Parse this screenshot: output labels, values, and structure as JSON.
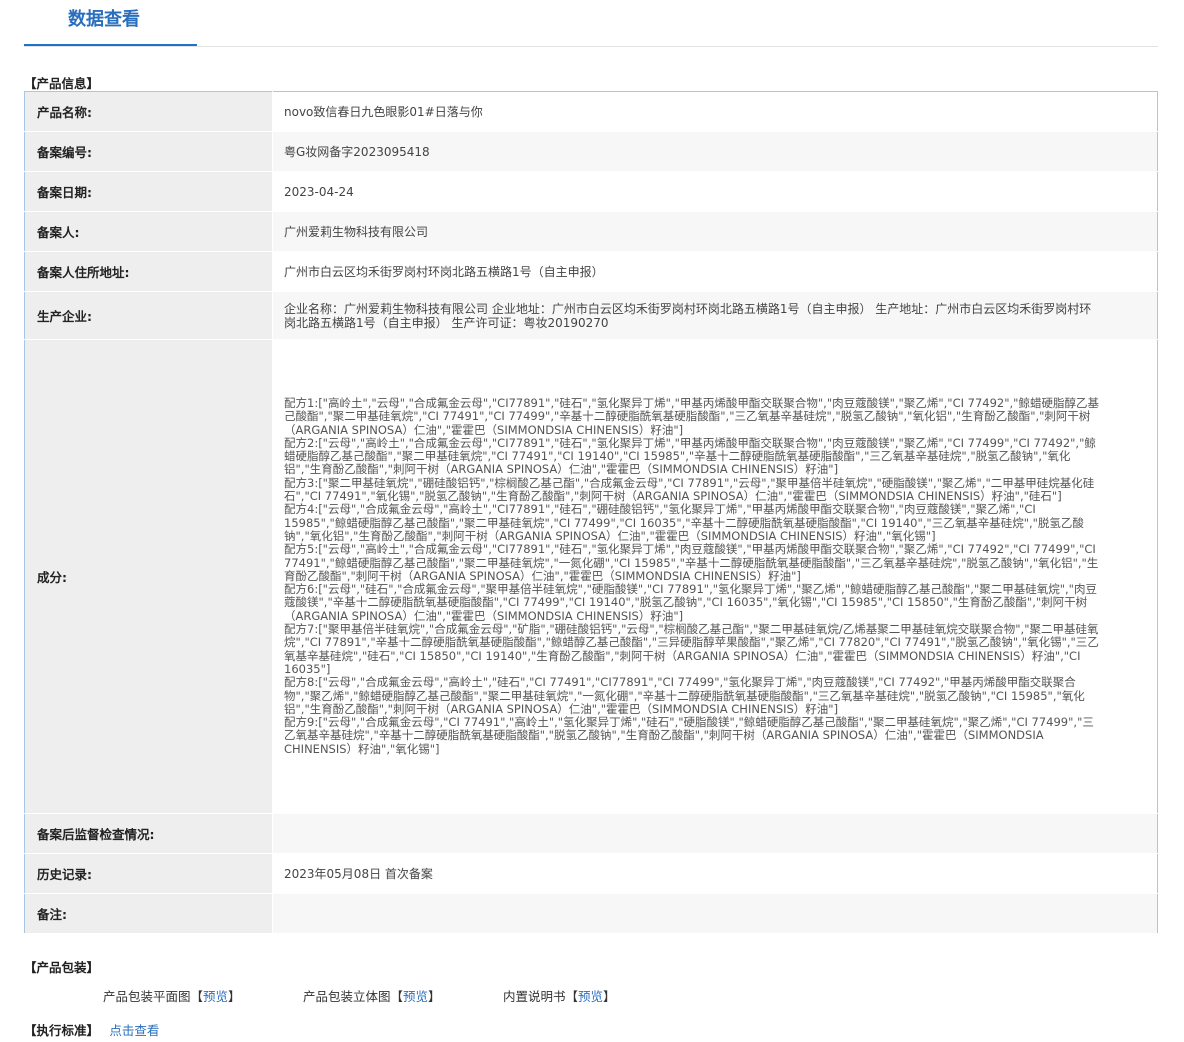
{
  "header": {
    "title": "数据查看"
  },
  "product_info": {
    "section_title": "【产品信息】",
    "rows": [
      {
        "label": "产品名称:",
        "value": "novo致信春日九色眼影01#日落与你"
      },
      {
        "label": "备案编号:",
        "value": "粤G妆网备字2023095418"
      },
      {
        "label": "备案日期:",
        "value": "2023-04-24"
      },
      {
        "label": "备案人:",
        "value": "广州爱莉生物科技有限公司"
      },
      {
        "label": "备案人住所地址:",
        "value": "广州市白云区均禾街罗岗村环岗北路五横路1号（自主申报）"
      },
      {
        "label": "生产企业:",
        "value": "企业名称：广州爱莉生物科技有限公司 企业地址：广州市白云区均禾街罗岗村环岗北路五横路1号（自主申报） 生产地址：广州市白云区均禾街罗岗村环岗北路五横路1号（自主申报） 生产许可证：粤妆20190270"
      }
    ],
    "ingredients": {
      "label": "成分:",
      "formulas": [
        "配方1:[\"高岭土\",\"云母\",\"合成氟金云母\",\"CI77891\",\"硅石\",\"氢化聚异丁烯\",\"甲基丙烯酸甲酯交联聚合物\",\"肉豆蔻酸镁\",\"聚乙烯\",\"CI 77492\",\"鲸蜡硬脂醇乙基己酸酯\",\"聚二甲基硅氧烷\",\"CI 77491\",\"CI 77499\",\"辛基十二醇硬脂酰氧基硬脂酸酯\",\"三乙氧基辛基硅烷\",\"脱氢乙酸钠\",\"氧化铝\",\"生育酚乙酸酯\",\"刺阿干树（ARGANIA SPINOSA）仁油\",\"霍霍巴（SIMMONDSIA CHINENSIS）籽油\"]",
        "配方2:[\"云母\",\"高岭土\",\"合成氟金云母\",\"CI77891\",\"硅石\",\"氢化聚异丁烯\",\"甲基丙烯酸甲酯交联聚合物\",\"肉豆蔻酸镁\",\"聚乙烯\",\"CI 77499\",\"CI 77492\",\"鲸蜡硬脂醇乙基己酸酯\",\"聚二甲基硅氧烷\",\"CI 77491\",\"CI 19140\",\"CI 15985\",\"辛基十二醇硬脂酰氧基硬脂酸酯\",\"三乙氧基辛基硅烷\",\"脱氢乙酸钠\",\"氧化铝\",\"生育酚乙酸酯\",\"刺阿干树（ARGANIA SPINOSA）仁油\",\"霍霍巴（SIMMONDSIA CHINENSIS）籽油\"]",
        "配方3:[\"聚二甲基硅氧烷\",\"硼硅酸铝钙\",\"棕榈酸乙基己酯\",\"合成氟金云母\",\"CI 77891\",\"云母\",\"聚甲基倍半硅氧烷\",\"硬脂酸镁\",\"聚乙烯\",\"二甲基甲硅烷基化硅石\",\"CI 77491\",\"氧化锡\",\"脱氢乙酸钠\",\"生育酚乙酸酯\",\"刺阿干树（ARGANIA SPINOSA）仁油\",\"霍霍巴（SIMMONDSIA CHINENSIS）籽油\",\"硅石\"]",
        "配方4:[\"云母\",\"合成氟金云母\",\"高岭土\",\"CI77891\",\"硅石\",\"硼硅酸铝钙\",\"氢化聚异丁烯\",\"甲基丙烯酸甲酯交联聚合物\",\"肉豆蔻酸镁\",\"聚乙烯\",\"CI 15985\",\"鲸蜡硬脂醇乙基己酸酯\",\"聚二甲基硅氧烷\",\"CI 77499\",\"CI 16035\",\"辛基十二醇硬脂酰氧基硬脂酸酯\",\"CI 19140\",\"三乙氧基辛基硅烷\",\"脱氢乙酸钠\",\"氧化铝\",\"生育酚乙酸酯\",\"刺阿干树（ARGANIA SPINOSA）仁油\",\"霍霍巴（SIMMONDSIA CHINENSIS）籽油\",\"氧化锡\"]",
        "配方5:[\"云母\",\"高岭土\",\"合成氟金云母\",\"CI77891\",\"硅石\",\"氢化聚异丁烯\",\"肉豆蔻酸镁\",\"甲基丙烯酸甲酯交联聚合物\",\"聚乙烯\",\"CI 77492\",\"CI 77499\",\"CI 77491\",\"鲸蜡硬脂醇乙基己酸酯\",\"聚二甲基硅氧烷\",\"一氮化硼\",\"CI 15985\",\"辛基十二醇硬脂酰氧基硬脂酸酯\",\"三乙氧基辛基硅烷\",\"脱氢乙酸钠\",\"氧化铝\",\"生育酚乙酸酯\",\"刺阿干树（ARGANIA SPINOSA）仁油\",\"霍霍巴（SIMMONDSIA CHINENSIS）籽油\"]",
        "配方6:[\"云母\",\"硅石\",\"合成氟金云母\",\"聚甲基倍半硅氧烷\",\"硬脂酸镁\",\"CI 77891\",\"氢化聚异丁烯\",\"聚乙烯\",\"鲸蜡硬脂醇乙基己酸酯\",\"聚二甲基硅氧烷\",\"肉豆蔻酸镁\",\"辛基十二醇硬脂酰氧基硬脂酸酯\",\"CI 77499\",\"CI 19140\",\"脱氢乙酸钠\",\"CI 16035\",\"氧化锡\",\"CI 15985\",\"CI 15850\",\"生育酚乙酸酯\",\"刺阿干树（ARGANIA SPINOSA）仁油\",\"霍霍巴（SIMMONDSIA CHINENSIS）籽油\"]",
        "配方7:[\"聚甲基倍半硅氧烷\",\"合成氟金云母\",\"矿脂\",\"硼硅酸铝钙\",\"云母\",\"棕榈酸乙基己酯\",\"聚二甲基硅氧烷/乙烯基聚二甲基硅氧烷交联聚合物\",\"聚二甲基硅氧烷\",\"CI 77891\",\"辛基十二醇硬脂酰氧基硬脂酸酯\",\"鲸蜡醇乙基己酸酯\",\"三异硬脂醇苹果酸酯\",\"聚乙烯\",\"CI 77820\",\"CI 77491\",\"脱氢乙酸钠\",\"氧化锡\",\"三乙氧基辛基硅烷\",\"硅石\",\"CI 15850\",\"CI 19140\",\"生育酚乙酸酯\",\"刺阿干树（ARGANIA SPINOSA）仁油\",\"霍霍巴（SIMMONDSIA CHINENSIS）籽油\",\"CI 16035\"]",
        "配方8:[\"云母\",\"合成氟金云母\",\"高岭土\",\"硅石\",\"CI 77491\",\"CI77891\",\"CI 77499\",\"氢化聚异丁烯\",\"肉豆蔻酸镁\",\"CI 77492\",\"甲基丙烯酸甲酯交联聚合物\",\"聚乙烯\",\"鲸蜡硬脂醇乙基己酸酯\",\"聚二甲基硅氧烷\",\"一氮化硼\",\"辛基十二醇硬脂酰氧基硬脂酸酯\",\"三乙氧基辛基硅烷\",\"脱氢乙酸钠\",\"CI 15985\",\"氧化铝\",\"生育酚乙酸酯\",\"刺阿干树（ARGANIA SPINOSA）仁油\",\"霍霍巴（SIMMONDSIA CHINENSIS）籽油\"]",
        "配方9:[\"云母\",\"合成氟金云母\",\"CI 77491\",\"高岭土\",\"氢化聚异丁烯\",\"硅石\",\"硬脂酸镁\",\"鲸蜡硬脂醇乙基己酸酯\",\"聚二甲基硅氧烷\",\"聚乙烯\",\"CI 77499\",\"三乙氧基辛基硅烷\",\"辛基十二醇硬脂酰氧基硬脂酸酯\",\"脱氢乙酸钠\",\"生育酚乙酸酯\",\"刺阿干树（ARGANIA SPINOSA）仁油\",\"霍霍巴（SIMMONDSIA CHINENSIS）籽油\",\"氧化锡\"]"
      ]
    },
    "rows_after": [
      {
        "label": "备案后监督检查情况:",
        "value": ""
      },
      {
        "label": "历史记录:",
        "value": "2023年05月08日 首次备案"
      },
      {
        "label": "备注:",
        "value": ""
      }
    ]
  },
  "packaging": {
    "section_title": "【产品包装】",
    "items": [
      {
        "label": "产品包装平面图",
        "bracket_open": "【",
        "link": "预览",
        "bracket_close": "】"
      },
      {
        "label": "产品包装立体图",
        "bracket_open": "【",
        "link": "预览",
        "bracket_close": "】"
      },
      {
        "label": "内置说明书",
        "bracket_open": "【",
        "link": "预览",
        "bracket_close": "】"
      }
    ]
  },
  "standard": {
    "section_title": "【执行标准】",
    "link": "点击查看"
  },
  "colors": {
    "accent": "#2a6fbe",
    "label_bg": "#eeeeee",
    "border": "#a9c6e6"
  }
}
